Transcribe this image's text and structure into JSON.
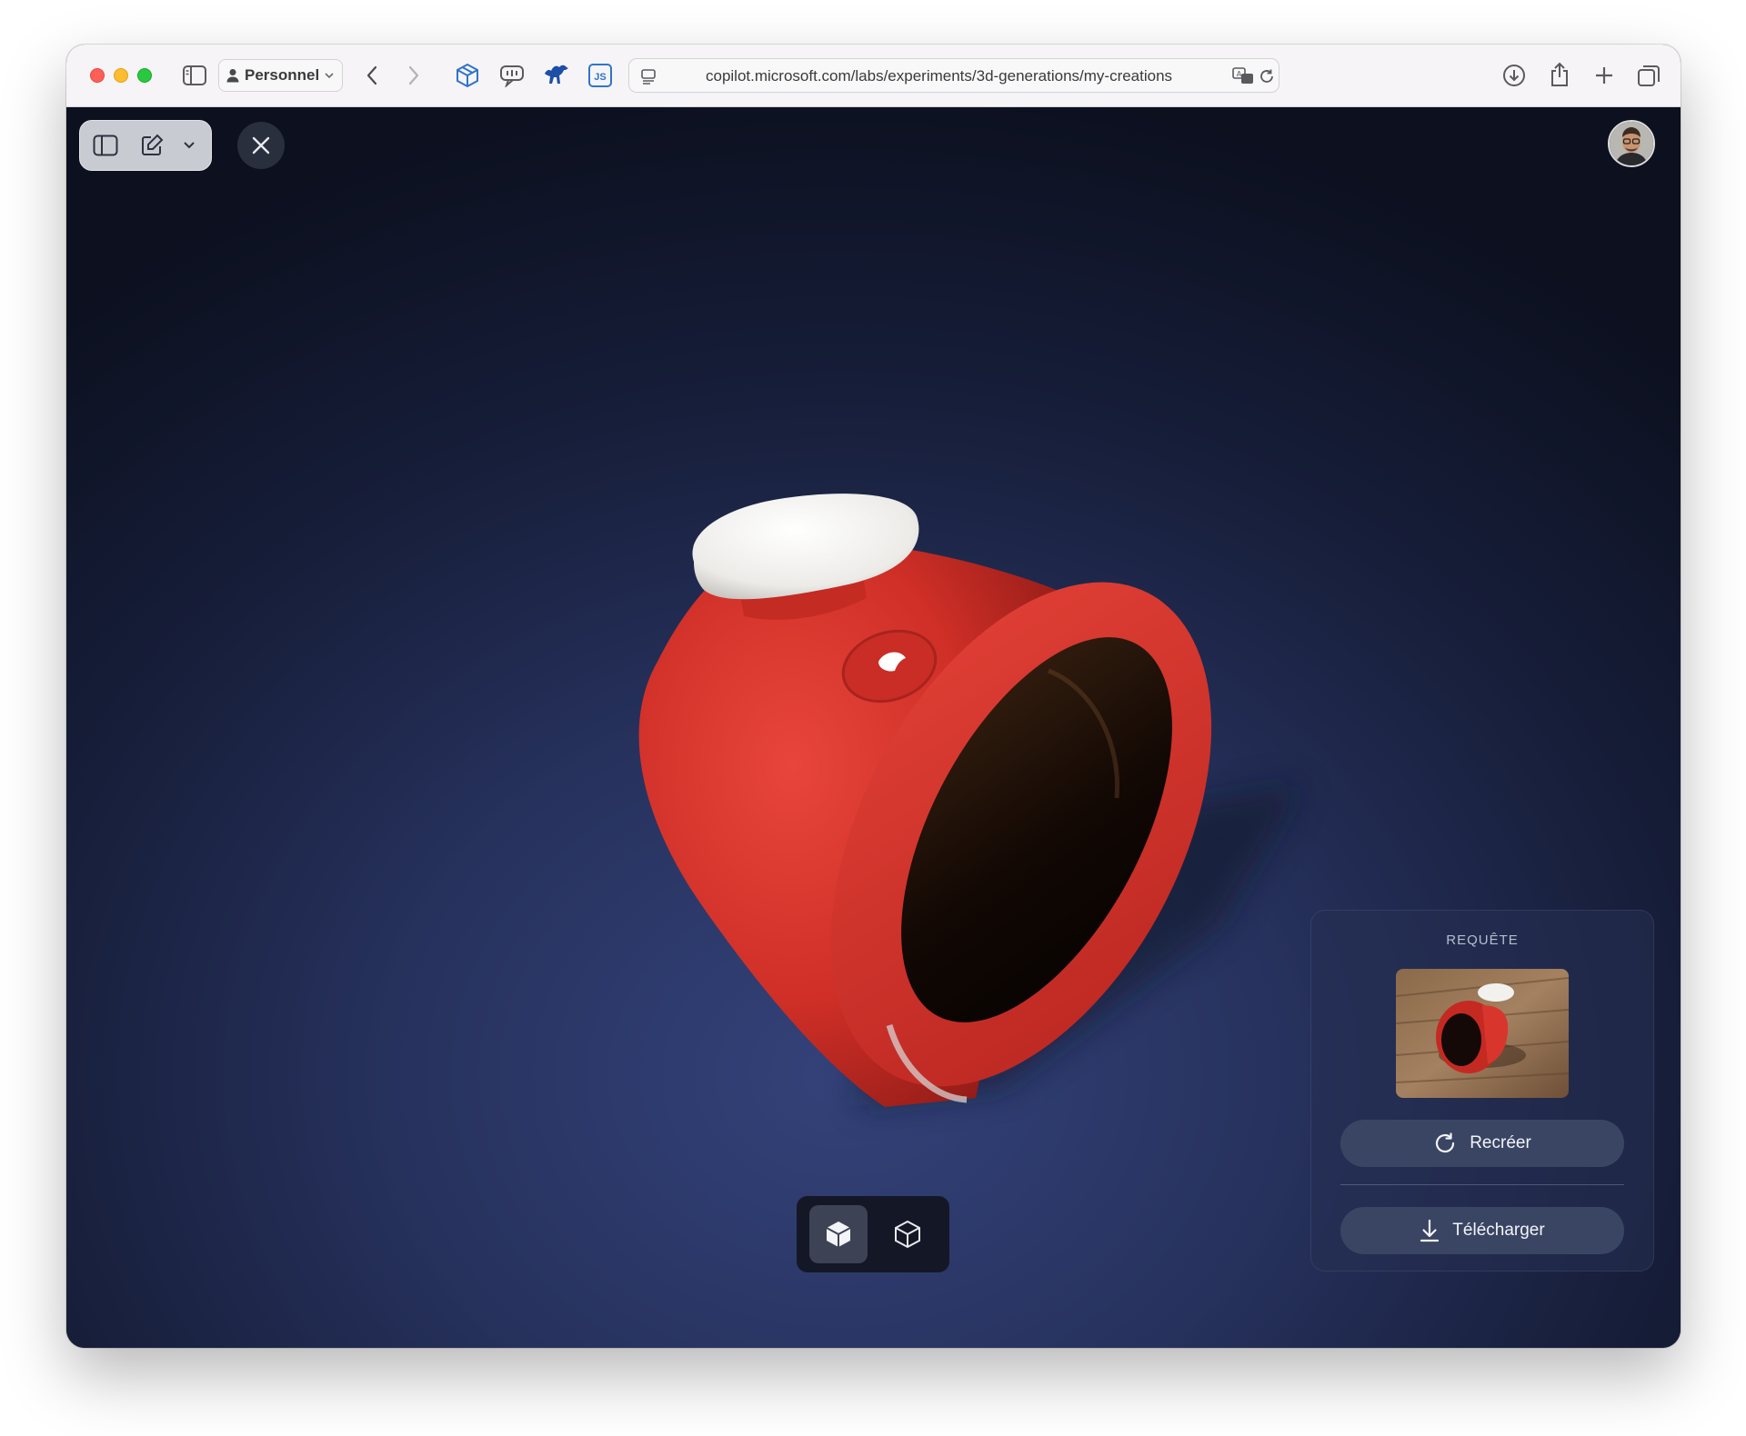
{
  "browser": {
    "profile_label": "Personnel",
    "url": "copilot.microsoft.com/labs/experiments/3d-generations/my-creations",
    "toolbar_icons": [
      "sidebar-icon",
      "chevron-left-icon",
      "chevron-right-icon",
      "package-icon",
      "speech-bubble-icon",
      "camel-icon",
      "js-icon",
      "page-icon",
      "translate-icon",
      "reload-icon",
      "download-icon",
      "share-icon",
      "plus-icon",
      "tabs-icon"
    ]
  },
  "viewer": {
    "top_left_icons": [
      "sidebar-toggle-icon",
      "new-chat-icon",
      "chevron-down-icon"
    ],
    "close_icon": "close-icon",
    "view_modes": [
      {
        "icon": "solid-cube-icon",
        "active": true
      },
      {
        "icon": "wireframe-cube-icon",
        "active": false
      }
    ]
  },
  "panel": {
    "title": "REQUÊTE",
    "recreate_label": "Recréer",
    "download_label": "Télécharger"
  },
  "colors": {
    "accent_red": "#d8332c",
    "panel_button": "#3a4563",
    "background_dark": "#0e1324"
  }
}
